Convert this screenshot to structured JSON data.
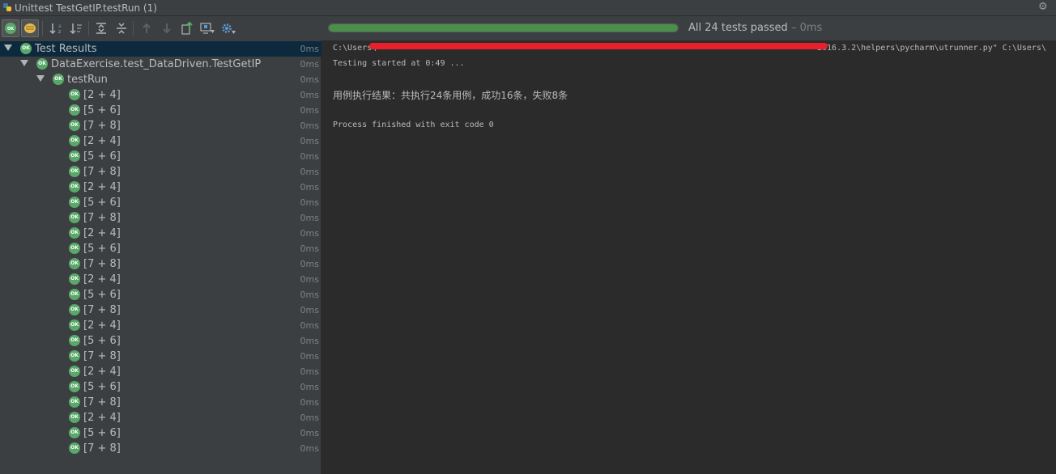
{
  "window": {
    "title": "Unittest TestGetIP.testRun (1)"
  },
  "toolbar": {
    "buttons": [
      "show-passed-icon",
      "show-ignored-icon",
      "sort-alpha-icon",
      "sort-duration-icon",
      "expand-all-icon",
      "collapse-all-icon",
      "previous-failed-icon",
      "next-failed-icon",
      "export-icon",
      "import-icon",
      "settings-icon"
    ]
  },
  "status": {
    "progress": 1.0,
    "text": "All 24 tests passed",
    "time": " – 0ms",
    "progress_color": "#4a8f4a"
  },
  "tree": {
    "root": {
      "label": "Test Results",
      "time": "0ms"
    },
    "suite": {
      "label": "DataExercise.test_DataDriven.TestGetIP",
      "time": "0ms"
    },
    "method": {
      "label": "testRun",
      "time": "0ms"
    },
    "ok_badge": "OK",
    "items": [
      {
        "label": "[2 + 4]",
        "time": "0ms"
      },
      {
        "label": "[5 + 6]",
        "time": "0ms"
      },
      {
        "label": "[7 + 8]",
        "time": "0ms"
      },
      {
        "label": "[2 + 4]",
        "time": "0ms"
      },
      {
        "label": "[5 + 6]",
        "time": "0ms"
      },
      {
        "label": "[7 + 8]",
        "time": "0ms"
      },
      {
        "label": "[2 + 4]",
        "time": "0ms"
      },
      {
        "label": "[5 + 6]",
        "time": "0ms"
      },
      {
        "label": "[7 + 8]",
        "time": "0ms"
      },
      {
        "label": "[2 + 4]",
        "time": "0ms"
      },
      {
        "label": "[5 + 6]",
        "time": "0ms"
      },
      {
        "label": "[7 + 8]",
        "time": "0ms"
      },
      {
        "label": "[2 + 4]",
        "time": "0ms"
      },
      {
        "label": "[5 + 6]",
        "time": "0ms"
      },
      {
        "label": "[7 + 8]",
        "time": "0ms"
      },
      {
        "label": "[2 + 4]",
        "time": "0ms"
      },
      {
        "label": "[5 + 6]",
        "time": "0ms"
      },
      {
        "label": "[7 + 8]",
        "time": "0ms"
      },
      {
        "label": "[2 + 4]",
        "time": "0ms"
      },
      {
        "label": "[5 + 6]",
        "time": "0ms"
      },
      {
        "label": "[7 + 8]",
        "time": "0ms"
      },
      {
        "label": "[2 + 4]",
        "time": "0ms"
      },
      {
        "label": "[5 + 6]",
        "time": "0ms"
      },
      {
        "label": "[7 + 8]",
        "time": "0ms"
      }
    ]
  },
  "console": {
    "line1_start": "C:\\Users\\",
    "line1_end": "2016.3.2\\helpers\\pycharm\\utrunner.py\" C:\\Users\\",
    "line2": "Testing started at 0:49 ...",
    "line3": "用例执行结果：共执行24条用例，成功16条，失败8条",
    "line4": "Process finished with exit code 0",
    "redaction_color": "#e8202a"
  }
}
